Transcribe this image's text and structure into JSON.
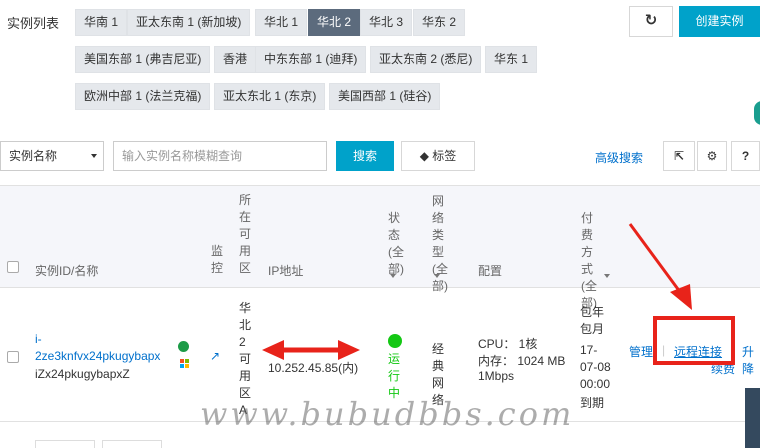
{
  "page": {
    "title": "实例列表"
  },
  "regions": {
    "row1": [
      "华南 1",
      "亚太东南 1 (新加坡)",
      "华北 1",
      "华北 2",
      "华北 3",
      "华东 2"
    ],
    "row2": [
      "美国东部 1 (弗吉尼亚)",
      "香港",
      "中东东部 1 (迪拜)",
      "亚太东南 2 (悉尼)",
      "华东 1"
    ],
    "row3": [
      "欧洲中部 1 (法兰克福)",
      "亚太东北 1 (东京)",
      "美国西部 1 (硅谷)"
    ],
    "active": "华北 2"
  },
  "toolbar": {
    "refresh_icon": "refresh-icon",
    "create_label": "创建实例",
    "filter_select": "实例名称",
    "search_placeholder": "输入实例名称模糊查询",
    "search_label": "搜索",
    "tag_label": "标签",
    "tag_icon": "tag-icon",
    "advanced_search": "高级搜索",
    "export_icon": "export-icon",
    "settings_icon": "gear-icon",
    "help_label": "?"
  },
  "table": {
    "headers": {
      "id_name": "实例ID/名称",
      "monitor": "监控",
      "zone": "所在可用区",
      "ip": "IP地址",
      "status": "状态(全部)",
      "network": "网络类型(全部)",
      "config": "配置",
      "billing": "付费方式(全部)"
    },
    "row": {
      "id_prefix": "i-",
      "id": "2ze3knfvx24pkugybapx",
      "name": "iZx24pkugybapxZ",
      "zone": "华北2可用区A",
      "ip": "10.252.45.85(内)",
      "status": "运行中",
      "network": "经典网络",
      "cpu": "CPU： 1核",
      "memory": "内存： 1024 MB",
      "bandwidth": "1Mbps",
      "billing": "包年包月",
      "date_line1": "17-",
      "date_line2": "07-08",
      "date_line3": "00:00",
      "expire": "到期",
      "manage": "管理",
      "separator": "|",
      "remote": "远程连接",
      "upgrade": "升降",
      "renew": "续费"
    }
  },
  "colors": {
    "accent": "#00a2ca",
    "active_region": "#5c6b7d",
    "link": "#0070cc",
    "annotation": "#e8231a",
    "running": "#14c814"
  },
  "watermark": {
    "text": "www.bubudbbs.com"
  }
}
